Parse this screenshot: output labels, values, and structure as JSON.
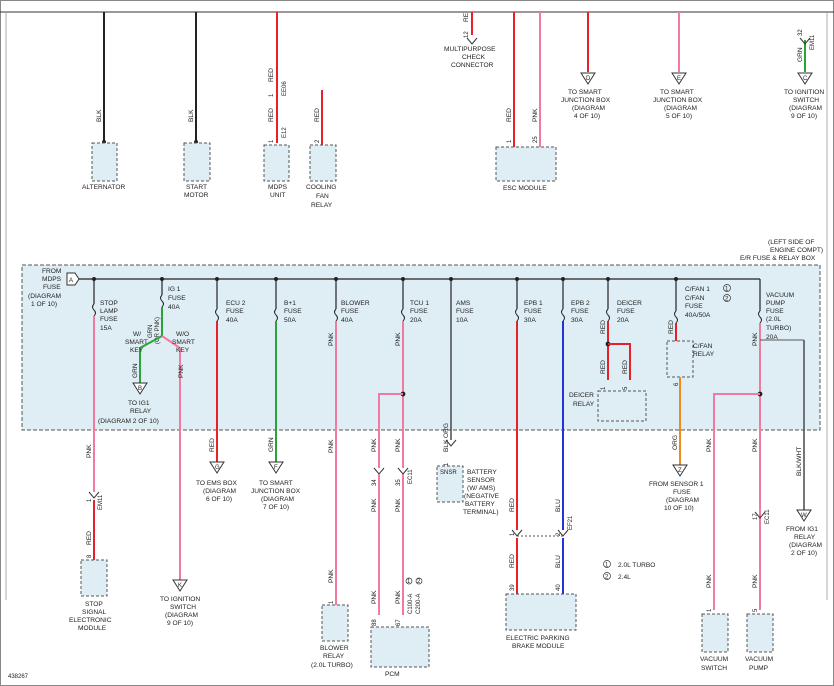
{
  "diagram_id": "438267",
  "colors": {
    "red": "#e8202a",
    "pink": "#f07aa0",
    "green": "#2aa43a",
    "blue": "#2233dd",
    "orange": "#ee8a1e",
    "black": "#222222",
    "gray": "#555555",
    "box_fill": "#dfeef4"
  },
  "top_components": {
    "alternator": {
      "name": "ALTERNATOR",
      "wire": "BLK"
    },
    "start_motor": {
      "name_l1": "START",
      "name_l2": "MOTOR",
      "wire": "BLK"
    },
    "mdps_unit": {
      "name_l1": "MDPS",
      "name_l2": "UNIT",
      "wire": "RED",
      "wire2": "RED",
      "conn": "EE06",
      "pin1": "1",
      "pin2": "E12",
      "pin2b": "1"
    },
    "cooling_fan_relay": {
      "name_l1": "COOLING",
      "name_l2": "FAN",
      "name_l3": "RELAY",
      "wire": "RED",
      "pin": "2"
    },
    "check_connector": {
      "name_l1": "MULTIPURPOSE",
      "name_l2": "CHECK",
      "name_l3": "CONNECTOR",
      "wire": "RE",
      "pin": "12"
    },
    "esc_module": {
      "name": "ESC MODULE",
      "wire1": "RED",
      "wire2": "PNK",
      "pin1": "1",
      "pin2": "25"
    },
    "ref_d": {
      "letter": "D",
      "l1": "TO SMART",
      "l2": "JUNCTION BOX",
      "l3": "(DIAGRAM",
      "l4": "4 OF 10)"
    },
    "ref_e": {
      "letter": "E",
      "l1": "TO SMART",
      "l2": "JUNCTION BOX",
      "l3": "(DIAGRAM",
      "l4": "5 OF 10)"
    },
    "ref_c": {
      "letter": "C",
      "l1": "TO IGNITION",
      "l2": "SWITCH",
      "l3": "(DIAGRAM",
      "l4": "9 OF 10)",
      "wire": "GRN",
      "conn": "EM11",
      "pin": "32"
    }
  },
  "fuse_box": {
    "title_l1": "(LEFT SIDE OF",
    "title_l2": "ENGINE COMPT)",
    "title_l3": "E/R FUSE & RELAY BOX",
    "from_l1": "FROM",
    "from_l2": "MDPS",
    "from_l3": "FUSE",
    "from_l4": "(DIAGRAM",
    "from_l5": "1 OF 10)",
    "ref_a": "A",
    "fuses": {
      "stop_lamp": {
        "l1": "STOP",
        "l2": "LAMP",
        "l3": "FUSE",
        "l4": "15A"
      },
      "ig1": {
        "l1": "IG 1",
        "l2": "FUSE",
        "l3": "40A"
      },
      "ecu2": {
        "l1": "ECU 2",
        "l2": "FUSE",
        "l3": "40A"
      },
      "bplus1": {
        "l1": "B+1",
        "l2": "FUSE",
        "l3": "50A"
      },
      "blower": {
        "l1": "BLOWER",
        "l2": "FUSE",
        "l3": "40A"
      },
      "tcu1": {
        "l1": "TCU 1",
        "l2": "FUSE",
        "l3": "20A"
      },
      "ams": {
        "l1": "AMS",
        "l2": "FUSE",
        "l3": "10A"
      },
      "epb1": {
        "l1": "EPB 1",
        "l2": "FUSE",
        "l3": "30A"
      },
      "epb2": {
        "l1": "EPB 2",
        "l2": "FUSE",
        "l3": "30A"
      },
      "deicer": {
        "l1": "DEICER",
        "l2": "FUSE",
        "l3": "20A"
      },
      "cfan": {
        "l1": "C/FAN 1",
        "l2": "C/FAN",
        "l3": "FUSE",
        "l4": "40A/50A"
      },
      "vacuum": {
        "l1": "VACUUM",
        "l2": "PUMP",
        "l3": "FUSE",
        "l4": "(2.0L",
        "l5": "TURBO)",
        "l6": "20A"
      }
    },
    "ig1_branch": {
      "wk_l1": "W/",
      "wk_l2": "SMART",
      "wk_l3": "KEY",
      "wok_l1": "W/O",
      "wok_l2": "SMART",
      "wok_l3": "KEY",
      "wire_l1": "GRN",
      "wire_l2": "(OR PNK)"
    },
    "deicer_relay": {
      "l1": "DEICER",
      "l2": "RELAY",
      "pin1": "1",
      "pin2": "5"
    },
    "cfan_relay": {
      "l1": "C/FAN",
      "l2": "RELAY",
      "pin": "6"
    },
    "notes": {
      "n1": "1",
      "n2": "2"
    }
  },
  "wires": {
    "pnk": "PNK",
    "red": "RED",
    "grn": "GRN",
    "blu": "BLU",
    "blk": "BLK",
    "org": "ORG",
    "blkwht": "BLK/WHT"
  },
  "bottom": {
    "stop_module": {
      "l1": "STOP",
      "l2": "SIGNAL",
      "l3": "ELECTRONIC",
      "l4": "MODULE",
      "conn": "EM11",
      "pin1": "1",
      "pin2": "8"
    },
    "ref_b": {
      "letter": "B",
      "l1": "TO IG1",
      "l2": "RELAY",
      "l3": "(DIAGRAM 2 OF 10)"
    },
    "ref_k": {
      "letter": "K",
      "l1": "TO IGNITION",
      "l2": "SWITCH",
      "l3": "(DIAGRAM",
      "l4": "9 OF 10)"
    },
    "ref_g": {
      "letter": "G",
      "l1": "TO EMS BOX",
      "l2": "(DIAGRAM",
      "l3": "6 OF 10)"
    },
    "ref_f": {
      "letter": "F",
      "l1": "TO SMART",
      "l2": "JUNCTION BOX",
      "l3": "(DIAGRAM",
      "l4": "7 OF 10)"
    },
    "blower_relay": {
      "l1": "BLOWER",
      "l2": "RELAY",
      "l3": "(2.0L TURBO)",
      "pin": "1"
    },
    "pcm": {
      "name": "PCM",
      "pin1": "88",
      "pin2": "67",
      "conn1": "C100-A",
      "conn2": "C200-A",
      "pin3": "34",
      "pin4": "35",
      "conn3": "EC11",
      "n1": "1",
      "n2": "2"
    },
    "battery_sensor": {
      "l1": "BATTERY",
      "l2": "SENSOR",
      "l3": "(W/ AMS)",
      "l4": "(NEGATIVE",
      "l5": "BATTERY",
      "l6": "TERMINAL)",
      "snsr": "SNSR",
      "pin": "1"
    },
    "epb_module": {
      "l1": "ELECTRIC PARKING",
      "l2": "BRAKE MODULE",
      "pin1": "39",
      "pin2": "40",
      "conn": "EF21",
      "pin3": "1",
      "pin4": "2"
    },
    "legend": {
      "n1": "1",
      "t1": "2.0L TURBO",
      "n2": "2",
      "t2": "2.4L"
    },
    "ref_z": {
      "letter": "Z",
      "l1": "FROM SENSOR 1",
      "l2": "FUSE",
      "l3": "(DIAGRAM",
      "l4": "10 OF 10)"
    },
    "ref_w": {
      "letter": "W",
      "l1": "FROM IG1",
      "l2": "RELAY",
      "l3": "(DIAGRAM",
      "l4": "2 OF 10)"
    },
    "vacuum_switch": {
      "l1": "VACUUM",
      "l2": "SWITCH",
      "pin": "1"
    },
    "vacuum_pump": {
      "l1": "VACUUM",
      "l2": "PUMP",
      "pin": "5",
      "conn": "EC11",
      "pin2": "17"
    }
  }
}
